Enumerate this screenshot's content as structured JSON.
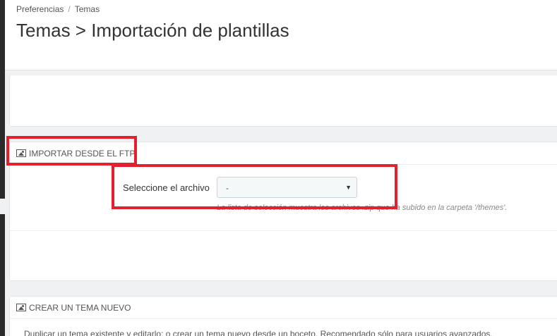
{
  "breadcrumb": {
    "items": [
      "Preferencias",
      "Temas"
    ],
    "separator": "/"
  },
  "page_title": "Temas > Importación de plantillas",
  "ftp_panel": {
    "heading": "IMPORTAR DESDE EL FTP",
    "icon": "image-icon",
    "file_label": "Seleccione el archivo",
    "file_select_value": "-",
    "help_text": "La lista de selección muestra los archivos .zip que ha subido en la carpeta '/themes'."
  },
  "new_theme_panel": {
    "heading": "CREAR UN TEMA NUEVO",
    "icon": "image-icon",
    "description": "Duplicar un tema existente y editarlo; o crear un tema nuevo desde un boceto. Recomendado sólo para usuarios avanzados."
  },
  "colors": {
    "highlight": "#e3202d",
    "page_background": "#eff1f2",
    "panel_background": "#ffffff"
  }
}
